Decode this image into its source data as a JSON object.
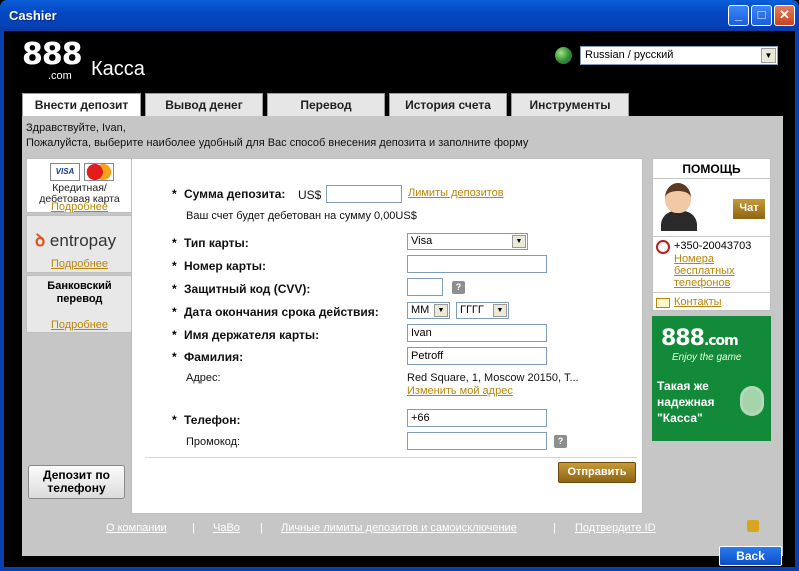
{
  "window": {
    "title": "Cashier"
  },
  "header": {
    "logo_number": "888",
    "logo_suffix": ".com",
    "title": "Касса",
    "language": "Russian / русский"
  },
  "tabs": [
    {
      "label": "Внести депозит",
      "active": true
    },
    {
      "label": "Вывод денег"
    },
    {
      "label": "Перевод"
    },
    {
      "label": "История счета"
    },
    {
      "label": "Инструменты"
    }
  ],
  "greeting": {
    "line1": "Здравствуйте, Ivan,",
    "line2": "Пожалуйста, выберите наиболее удобный для Вас способ внесения депозита и заполните форму"
  },
  "methods": [
    {
      "card1": "VISA",
      "card2": "MasterCard",
      "label_line1": "Кредитная/",
      "label_line2": "дебетовая карта",
      "more": "Подробнее"
    },
    {
      "logo": "entropay",
      "more": "Подробнее"
    },
    {
      "label_line1": "Банковский",
      "label_line2": "перевод",
      "more": "Подробнее"
    }
  ],
  "phone_deposit": {
    "line1": "Депозит по",
    "line2": "телефону"
  },
  "form": {
    "amount_label": "Сумма депозита:",
    "currency": "US$",
    "amount_value": "",
    "limits_link": "Лимиты депозитов",
    "debit_note": "Ваш счет будет дебетован на сумму 0,00US$",
    "card_type_label": "Тип карты:",
    "card_type_value": "Visa",
    "card_number_label": "Номер карты:",
    "card_number_value": "",
    "cvv_label": "Защитный код (CVV):",
    "cvv_value": "",
    "expiry_label": "Дата окончания срока действия:",
    "expiry_month": "ММ",
    "expiry_year": "ГГГГ",
    "holder_label": "Имя держателя карты:",
    "holder_value": "Ivan",
    "surname_label": "Фамилия:",
    "surname_value": "Petroff",
    "address_label": "Адрес:",
    "address_value": "Red Square, 1, Moscow 20150, T...",
    "change_address_link": "Изменить мой адрес",
    "phone_label": "Телефон:",
    "phone_value": "+66",
    "promo_label": "Промокод:",
    "promo_value": "",
    "required_mark": "*",
    "help_mark": "?",
    "submit": "Отправить"
  },
  "help": {
    "title": "ПОМОЩЬ",
    "chat": "Чат",
    "phone": "+350-20043703",
    "free_numbers_line1": "Номера",
    "free_numbers_line2": "бесплатных",
    "free_numbers_line3": "телефонов",
    "contacts": "Контакты"
  },
  "promo": {
    "brand": "888",
    "brand_suffix": ".com",
    "tagline": "Enjoy the game",
    "line1": "Такая же",
    "line2": "надежная",
    "line3": "\"Касса\""
  },
  "footer": {
    "links": [
      "О компании",
      "ЧаВо",
      "Личные лимиты депозитов и самоисключение",
      "Подтвердите ID"
    ],
    "separator": "|"
  },
  "back_button": "Back",
  "colors": {
    "window_blue": "#0548c4",
    "link_gold": "#b8860b",
    "promo_green": "#128a3a"
  }
}
